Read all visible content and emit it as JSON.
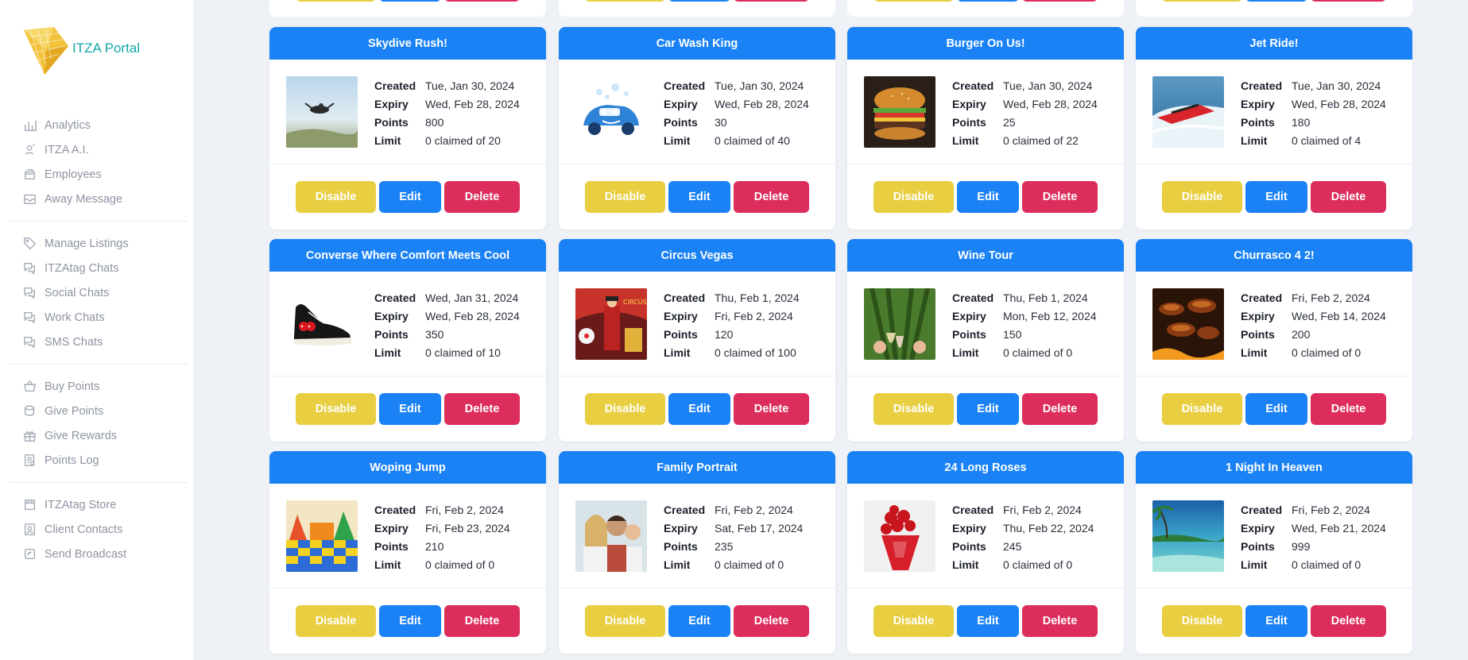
{
  "brand": {
    "name": "ITZA Portal"
  },
  "nav": {
    "groups": [
      [
        {
          "label": "Analytics",
          "icon": "chart-icon"
        },
        {
          "label": "ITZA A.I.",
          "icon": "ai-icon"
        },
        {
          "label": "Employees",
          "icon": "employees-icon"
        },
        {
          "label": "Away Message",
          "icon": "inbox-icon"
        }
      ],
      [
        {
          "label": "Manage Listings",
          "icon": "tag-icon"
        },
        {
          "label": "ITZAtag Chats",
          "icon": "chat-icon"
        },
        {
          "label": "Social Chats",
          "icon": "chat-icon"
        },
        {
          "label": "Work Chats",
          "icon": "chat-icon"
        },
        {
          "label": "SMS Chats",
          "icon": "chat-icon"
        }
      ],
      [
        {
          "label": "Buy Points",
          "icon": "basket-icon"
        },
        {
          "label": "Give Points",
          "icon": "coin-icon"
        },
        {
          "label": "Give Rewards",
          "icon": "gift-icon"
        },
        {
          "label": "Points Log",
          "icon": "log-icon"
        }
      ],
      [
        {
          "label": "ITZAtag Store",
          "icon": "store-icon"
        },
        {
          "label": "Client Contacts",
          "icon": "contact-icon"
        },
        {
          "label": "Send Broadcast",
          "icon": "broadcast-icon"
        }
      ]
    ]
  },
  "labels": {
    "created": "Created",
    "expiry": "Expiry",
    "points": "Points",
    "limit": "Limit"
  },
  "buttons": {
    "disable": "Disable",
    "edit": "Edit",
    "delete": "Delete"
  },
  "colors": {
    "primary": "#1a82f5",
    "warning": "#e8ce40",
    "danger": "#dc2d5c",
    "brand": "#14a6a8"
  },
  "cards": [
    {
      "title": "Skydive Rush!",
      "created": "Tue, Jan 30, 2024",
      "expiry": "Wed, Feb 28, 2024",
      "points": "800",
      "limit": "0 claimed of 20",
      "image": "skydive"
    },
    {
      "title": "Car Wash King",
      "created": "Tue, Jan 30, 2024",
      "expiry": "Wed, Feb 28, 2024",
      "points": "30",
      "limit": "0 claimed of 40",
      "image": "carwash"
    },
    {
      "title": "Burger On Us!",
      "created": "Tue, Jan 30, 2024",
      "expiry": "Wed, Feb 28, 2024",
      "points": "25",
      "limit": "0 claimed of 22",
      "image": "burger"
    },
    {
      "title": "Jet Ride!",
      "created": "Tue, Jan 30, 2024",
      "expiry": "Wed, Feb 28, 2024",
      "points": "180",
      "limit": "0 claimed of 4",
      "image": "jetboat"
    },
    {
      "title": "Converse Where Comfort Meets Cool",
      "created": "Wed, Jan 31, 2024",
      "expiry": "Wed, Feb 28, 2024",
      "points": "350",
      "limit": "0 claimed of 10",
      "image": "sneaker"
    },
    {
      "title": "Circus Vegas",
      "created": "Thu, Feb 1, 2024",
      "expiry": "Fri, Feb 2, 2024",
      "points": "120",
      "limit": "0 claimed of 100",
      "image": "circus"
    },
    {
      "title": "Wine Tour",
      "created": "Thu, Feb 1, 2024",
      "expiry": "Mon, Feb 12, 2024",
      "points": "150",
      "limit": "0 claimed of 0",
      "image": "wine"
    },
    {
      "title": "Churrasco 4 2!",
      "created": "Fri, Feb 2, 2024",
      "expiry": "Wed, Feb 14, 2024",
      "points": "200",
      "limit": "0 claimed of 0",
      "image": "grill"
    },
    {
      "title": "Woping Jump",
      "created": "Fri, Feb 2, 2024",
      "expiry": "Fri, Feb 23, 2024",
      "points": "210",
      "limit": "0 claimed of 0",
      "image": "bounce"
    },
    {
      "title": "Family Portrait",
      "created": "Fri, Feb 2, 2024",
      "expiry": "Sat, Feb 17, 2024",
      "points": "235",
      "limit": "0 claimed of 0",
      "image": "family"
    },
    {
      "title": "24 Long Roses",
      "created": "Fri, Feb 2, 2024",
      "expiry": "Thu, Feb 22, 2024",
      "points": "245",
      "limit": "0 claimed of 0",
      "image": "roses"
    },
    {
      "title": "1 Night In Heaven",
      "created": "Fri, Feb 2, 2024",
      "expiry": "Wed, Feb 21, 2024",
      "points": "999",
      "limit": "0 claimed of 0",
      "image": "beach"
    }
  ]
}
